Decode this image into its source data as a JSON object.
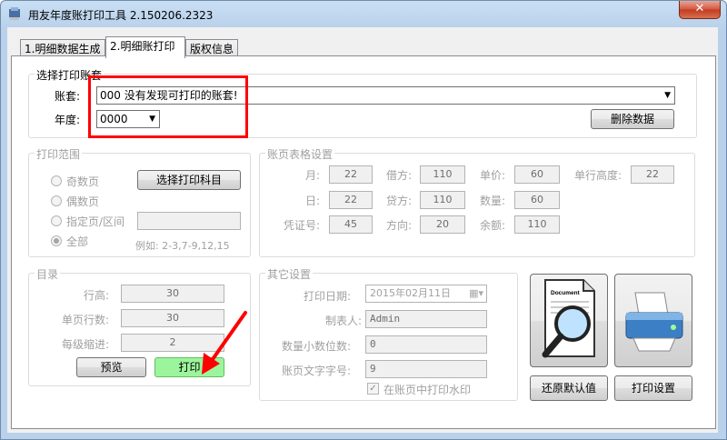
{
  "window": {
    "title": "用友年度账打印工具 2.150206.2323",
    "close_label": "✕"
  },
  "tabs": [
    "1.明细数据生成",
    "2.明细账打印",
    "版权信息"
  ],
  "account_group": {
    "title": "选择打印账套",
    "account_label": "账套:",
    "account_value": "000 没有发现可打印的账套!",
    "year_label": "年度:",
    "year_value": "0000",
    "delete_button": "删除数据"
  },
  "print_range": {
    "title": "打印范围",
    "select_subject_button": "选择打印科目",
    "options": [
      "奇数页",
      "偶数页",
      "指定页/区间",
      "全部"
    ],
    "selected": "全部",
    "example": "例如: 2-3,7-9,12,15"
  },
  "table_format": {
    "title": "账页表格设置",
    "fields": [
      {
        "label": "月:",
        "value": "22"
      },
      {
        "label": "借方:",
        "value": "110"
      },
      {
        "label": "单价:",
        "value": "60"
      },
      {
        "label": "单行高度:",
        "value": "22"
      },
      {
        "label": "日:",
        "value": "22"
      },
      {
        "label": "贷方:",
        "value": "110"
      },
      {
        "label": "数量:",
        "value": "60"
      },
      {
        "label": "凭证号:",
        "value": "45"
      },
      {
        "label": "方向:",
        "value": "20"
      },
      {
        "label": "余额:",
        "value": "110"
      }
    ]
  },
  "catalog": {
    "title": "目录",
    "fields": [
      {
        "label": "行高:",
        "value": "30"
      },
      {
        "label": "单页行数:",
        "value": "30"
      },
      {
        "label": "每级缩进:",
        "value": "2"
      }
    ],
    "preview_button": "预览",
    "print_button": "打印"
  },
  "other": {
    "title": "其它设置",
    "print_date_label": "打印日期:",
    "print_date_value": "2015年02月11日",
    "preparer_label": "制表人:",
    "preparer_value": "Admin",
    "decimals_label": "数量小数位数:",
    "decimals_value": "0",
    "font_size_label": "账页文字字号:",
    "font_size_value": "9",
    "watermark_label": "在账页中打印水印",
    "watermark_checked": true
  },
  "actions": {
    "restore_defaults": "还原默认值",
    "print_settings": "打印设置",
    "document_icon_text": "Document"
  },
  "colors": {
    "annotation_red": "#ff0000",
    "print_button_green": "#9cf59c"
  }
}
